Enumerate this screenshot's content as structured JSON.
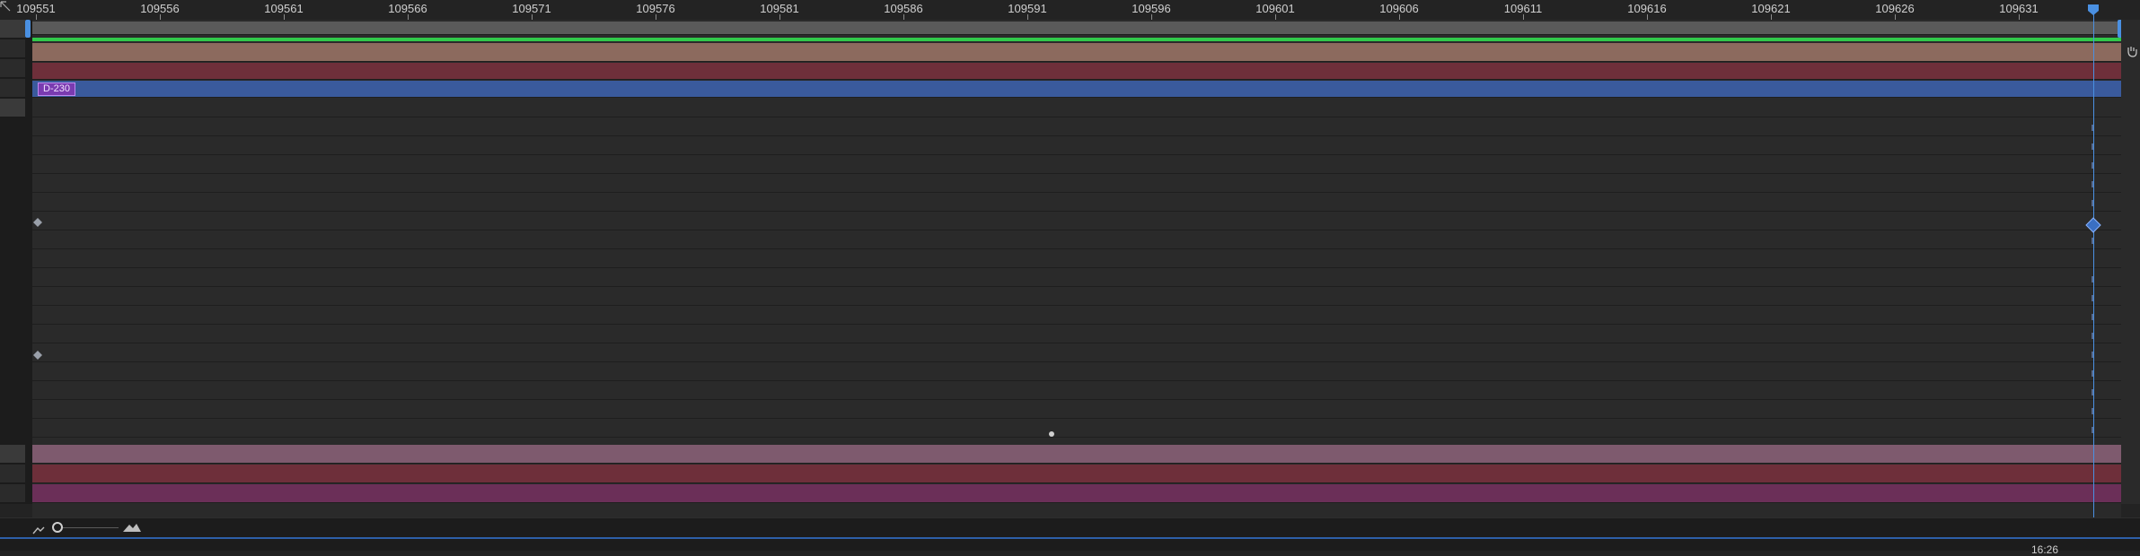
{
  "ruler": {
    "labels": [
      "109551",
      "109556",
      "109561",
      "109566",
      "109571",
      "109576",
      "109581",
      "109586",
      "109591",
      "109596",
      "109601",
      "109606",
      "109611",
      "109616",
      "109621",
      "109626",
      "109631"
    ]
  },
  "clip": {
    "label": "D-230"
  },
  "footer": {
    "time_label": "16:26"
  },
  "colors": {
    "green_bar": "#31c94a",
    "orange_track": "#8c6a5e",
    "red_track": "#6e2f3a",
    "blue_track": "#3a5a9c",
    "pink_track": "#7e5a6e",
    "magenta_track": "#6b2f58",
    "playhead": "#4a90e2"
  },
  "icons": {
    "corner": "corner-arrow-icon",
    "zoom_out": "zoom-out-mountain-icon",
    "zoom_in": "zoom-in-mountain-icon",
    "zoom_knob": "zoom-slider-knob-icon"
  }
}
